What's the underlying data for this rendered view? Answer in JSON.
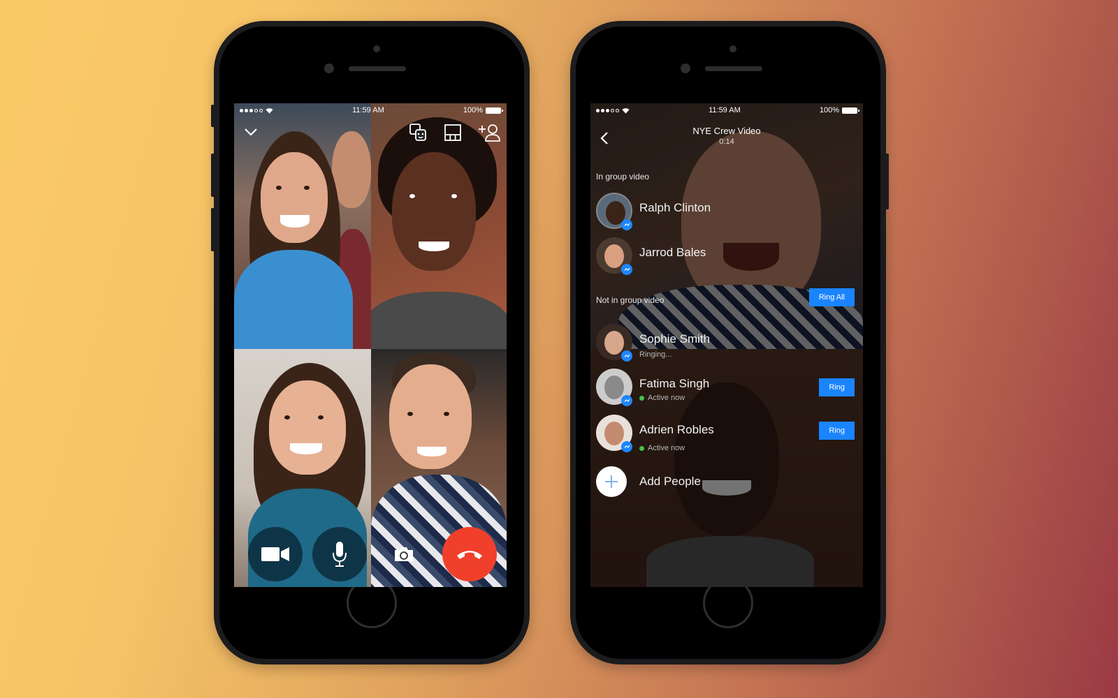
{
  "colors": {
    "messenger_blue": "#1a84ff",
    "end_call_red": "#f0402c",
    "active_green": "#44c24a",
    "background_start": "#fbca68",
    "background_end": "#9a3a44"
  },
  "left_phone": {
    "status_bar": {
      "time": "11:59 AM",
      "battery": "100%"
    },
    "top_icons": [
      "chevron-down-icon",
      "masks-effects-icon",
      "layout-icon",
      "add-person-icon"
    ],
    "tiles": [
      {
        "name": "participant-tile-1"
      },
      {
        "name": "participant-tile-2"
      },
      {
        "name": "participant-tile-3"
      },
      {
        "name": "participant-tile-4"
      }
    ],
    "controls": [
      "video-camera-icon",
      "microphone-icon",
      "flip-camera-icon",
      "end-call-icon"
    ]
  },
  "right_phone": {
    "status_bar": {
      "time": "11:59 AM",
      "battery": "100%"
    },
    "header": {
      "title": "NYE Crew Video",
      "timer": "0:14"
    },
    "in_group_label": "In group video",
    "not_in_group_label": "Not in group video",
    "ring_all_label": "Ring All",
    "in_group": [
      {
        "name": "Ralph Clinton"
      },
      {
        "name": "Jarrod Bales"
      }
    ],
    "not_in_group": [
      {
        "name": "Sophie Smith",
        "status": "Ringing...",
        "active": false,
        "ring_label": ""
      },
      {
        "name": "Fatima Singh",
        "status": "Active now",
        "active": true,
        "ring_label": "Ring"
      },
      {
        "name": "Adrien Robles",
        "status": "Active now",
        "active": true,
        "ring_label": "Ring"
      }
    ],
    "add_people_label": "Add People"
  }
}
